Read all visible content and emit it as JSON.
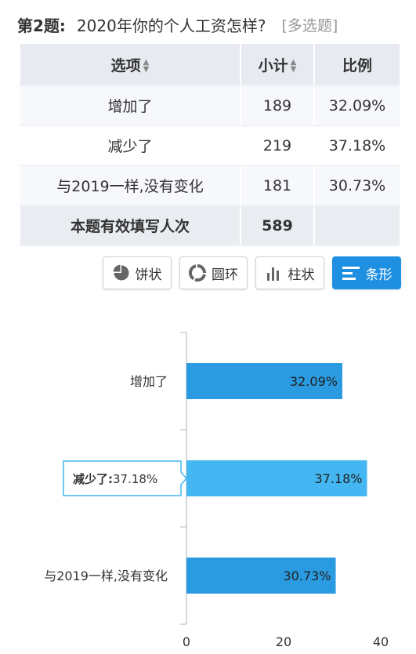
{
  "question": {
    "number": "第2题:",
    "title": "2020年你的个人工资怎样?",
    "tag": "[多选题]"
  },
  "table": {
    "headers": [
      "选项",
      "小计",
      "比例"
    ],
    "rows": [
      {
        "option": "增加了",
        "count": "189",
        "ratio": "32.09%"
      },
      {
        "option": "减少了",
        "count": "219",
        "ratio": "37.18%"
      },
      {
        "option": "与2019一样,没有变化",
        "count": "181",
        "ratio": "30.73%"
      }
    ],
    "total_label": "本题有效填写人次",
    "total_count": "589"
  },
  "chart_buttons": {
    "pie": "饼状",
    "ring": "圆环",
    "column": "柱状",
    "bar": "条形",
    "active": "bar"
  },
  "colors": {
    "accent": "#1e8fe1",
    "bar": "#2a9be0",
    "bar_hover": "#44b6f2"
  },
  "chart_data": {
    "type": "bar",
    "orientation": "horizontal",
    "categories": [
      "增加了",
      "减少了",
      "与2019一样,没有变化"
    ],
    "values": [
      32.09,
      37.18,
      30.73
    ],
    "value_labels": [
      "32.09%",
      "37.18%",
      "30.73%"
    ],
    "xlim": [
      0,
      40
    ],
    "x_ticks": [
      "0",
      "20",
      "40"
    ],
    "tooltip": {
      "category": "减少了",
      "text": "减少了:37.18%"
    }
  }
}
